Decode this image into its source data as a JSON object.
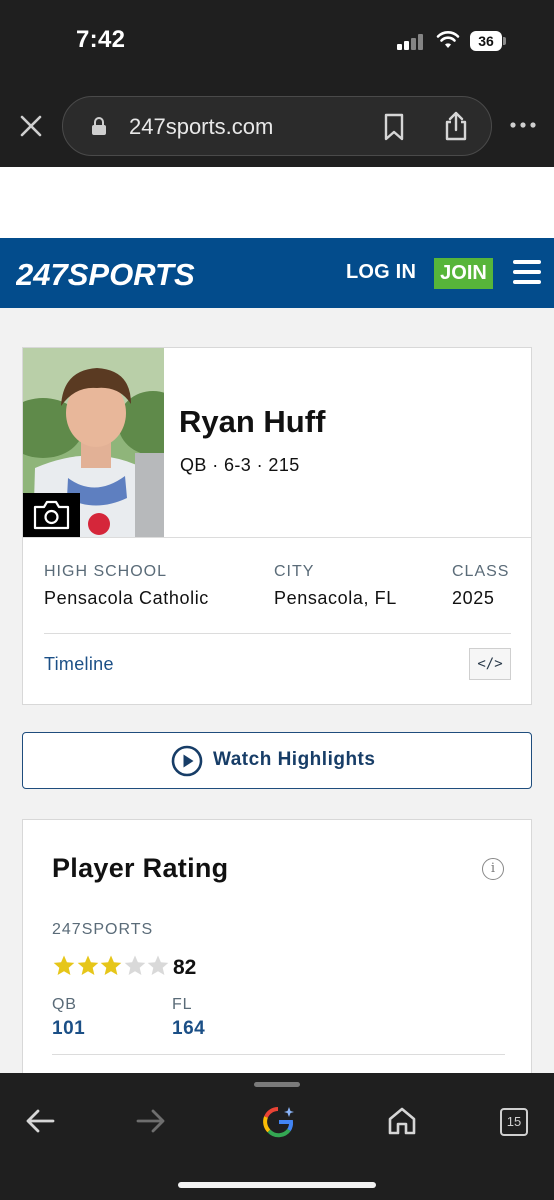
{
  "status_bar": {
    "time": "7:42",
    "battery": "36"
  },
  "browser": {
    "url": "247sports.com",
    "tab_count": "15"
  },
  "site_header": {
    "logo_text": "247SPORTS",
    "login_label": "LOG IN",
    "join_label": "JOIN"
  },
  "player": {
    "name": "Ryan Huff",
    "meta": "QB · 6-3 · 215",
    "info": [
      {
        "label": "HIGH SCHOOL",
        "value": "Pensacola Catholic"
      },
      {
        "label": "CITY",
        "value": "Pensacola, FL"
      },
      {
        "label": "CLASS",
        "value": "2025"
      }
    ],
    "timeline_label": "Timeline",
    "embed_label": "</>"
  },
  "watch_highlights_label": "Watch Highlights",
  "rating": {
    "title": "Player Rating",
    "info_icon": "i",
    "source": "247SPORTS",
    "stars_filled": 3,
    "stars_total": 5,
    "score": "82",
    "ranks": [
      {
        "label": "QB",
        "value": "101"
      },
      {
        "label": "FL",
        "value": "164"
      }
    ]
  },
  "colors": {
    "brand_blue": "#034c8c",
    "join_green": "#57b53a",
    "star_gold": "#e6c619",
    "link_blue": "#1b4f86"
  },
  "icons": [
    "close-icon",
    "lock-icon",
    "bookmark-icon",
    "share-icon",
    "more-icon",
    "menu-icon",
    "camera-icon",
    "code-icon",
    "play-icon",
    "info-icon",
    "star-icon",
    "back-icon",
    "forward-icon",
    "google-icon",
    "home-icon",
    "tabs-icon"
  ]
}
